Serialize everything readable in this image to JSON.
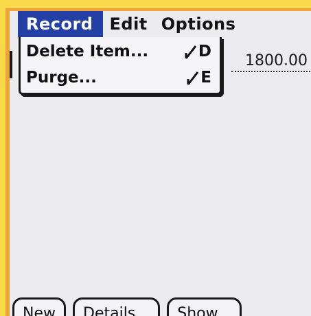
{
  "menubar": {
    "items": [
      {
        "label": "Record",
        "active": true
      },
      {
        "label": "Edit",
        "active": false
      },
      {
        "label": "Options",
        "active": false
      }
    ]
  },
  "record_menu": {
    "items": [
      {
        "label": "Delete Item...",
        "shortcut": "D"
      },
      {
        "label": "Purge...",
        "shortcut": "E"
      }
    ]
  },
  "field": {
    "separator": ";",
    "amount": "1800.00"
  },
  "buttons": {
    "new": "New",
    "details": "Details...",
    "show": "Show..."
  },
  "colors": {
    "menu_highlight": "#2440a4",
    "screen_bg": "#ecebee",
    "frame_orange": "#f2a23a",
    "frame_yellow": "#f7d94a"
  }
}
